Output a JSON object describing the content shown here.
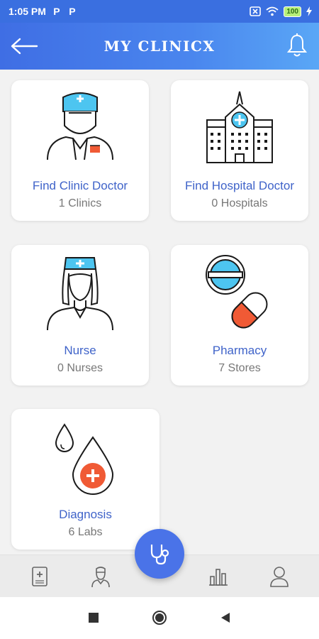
{
  "status_bar": {
    "time": "1:05 PM",
    "app_icons": [
      "P",
      "P"
    ],
    "battery": "100"
  },
  "header": {
    "title": "MY CLINICX"
  },
  "cards": [
    {
      "title": "Find Clinic Doctor",
      "subtitle": "1 Clinics",
      "icon": "doctor-icon"
    },
    {
      "title": "Find Hospital Doctor",
      "subtitle": "0 Hospitals",
      "icon": "hospital-icon"
    },
    {
      "title": "Nurse",
      "subtitle": "0 Nurses",
      "icon": "nurse-icon"
    },
    {
      "title": "Pharmacy",
      "subtitle": "7 Stores",
      "icon": "pills-icon"
    },
    {
      "title": "Diagnosis",
      "subtitle": "6 Labs",
      "icon": "blood-drop-icon"
    }
  ],
  "bottom_nav": {
    "items": [
      "medical-record-icon",
      "doctor-profile-icon",
      "stethoscope-icon",
      "stats-icon",
      "user-icon"
    ]
  },
  "colors": {
    "header": "#3f6ee4",
    "card_title": "#3f63c9",
    "accent_red": "#f05a35",
    "accent_cyan": "#4dc5f0",
    "fab": "#4a73e8"
  }
}
